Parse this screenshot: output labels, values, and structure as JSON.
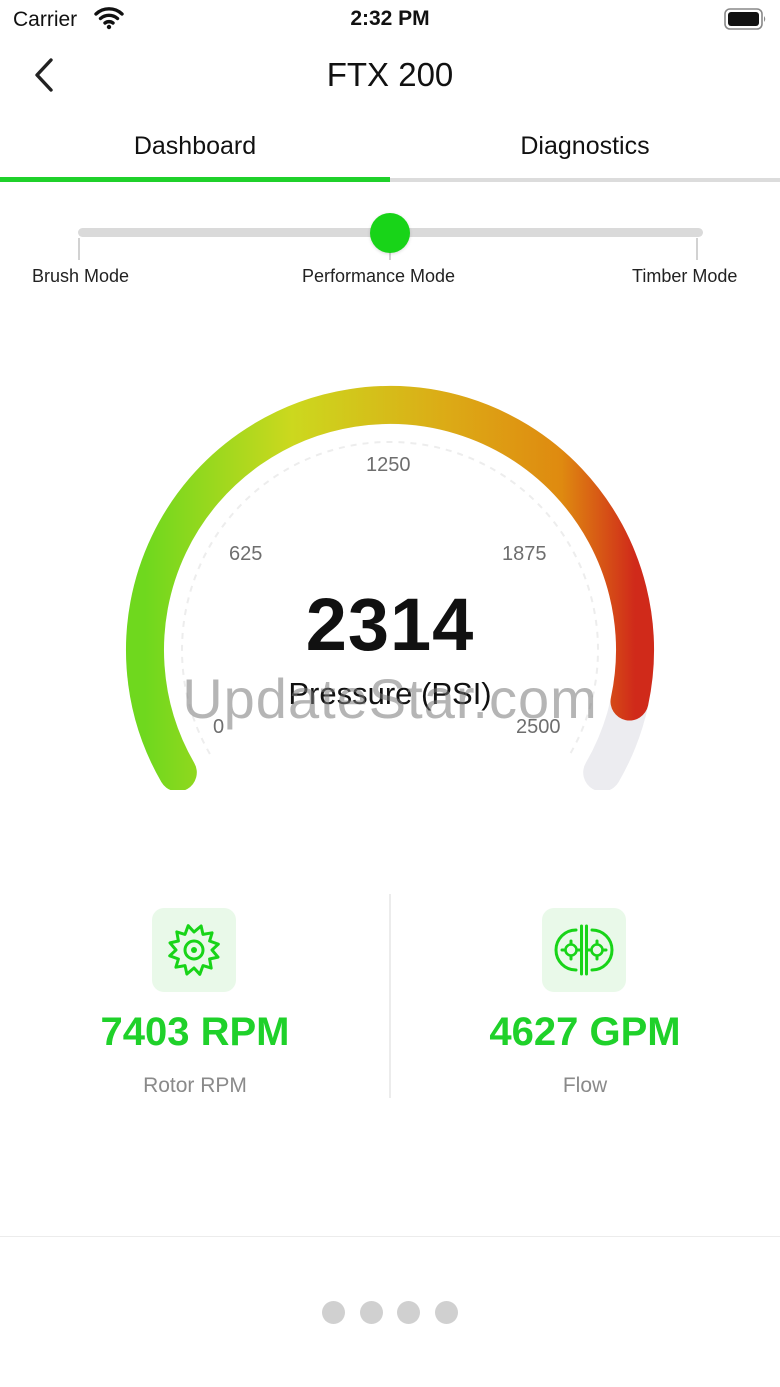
{
  "status_bar": {
    "carrier": "Carrier",
    "time": "2:32 PM"
  },
  "nav": {
    "title": "FTX 200",
    "back_icon": "chevron-left-icon"
  },
  "tabs": [
    {
      "label": "Dashboard",
      "active": true
    },
    {
      "label": "Diagnostics",
      "active": false
    }
  ],
  "mode_slider": {
    "modes": [
      "Brush Mode",
      "Performance Mode",
      "Timber Mode"
    ],
    "selected": "Performance Mode",
    "accent": "#18d418"
  },
  "gauge": {
    "value": "2314",
    "label": "Pressure (PSI)",
    "min": 0,
    "max": 2500,
    "current": 2314,
    "ticks": [
      "0",
      "625",
      "1250",
      "1875",
      "2500"
    ],
    "colors": {
      "start": "#73d81f",
      "mid": "#d8b81a",
      "end": "#d02a1a",
      "track": "#ececf0"
    }
  },
  "metrics": [
    {
      "value": "7403 RPM",
      "label": "Rotor RPM",
      "icon": "saw-blade-icon"
    },
    {
      "value": "4627 GPM",
      "label": "Flow",
      "icon": "flow-gears-icon"
    }
  ],
  "pager": {
    "count": 4,
    "active_index": 0
  },
  "watermark": "UpdateStar.com",
  "colors": {
    "accent": "#1fd12a",
    "text": "#111111",
    "muted": "#8a8a8a"
  }
}
